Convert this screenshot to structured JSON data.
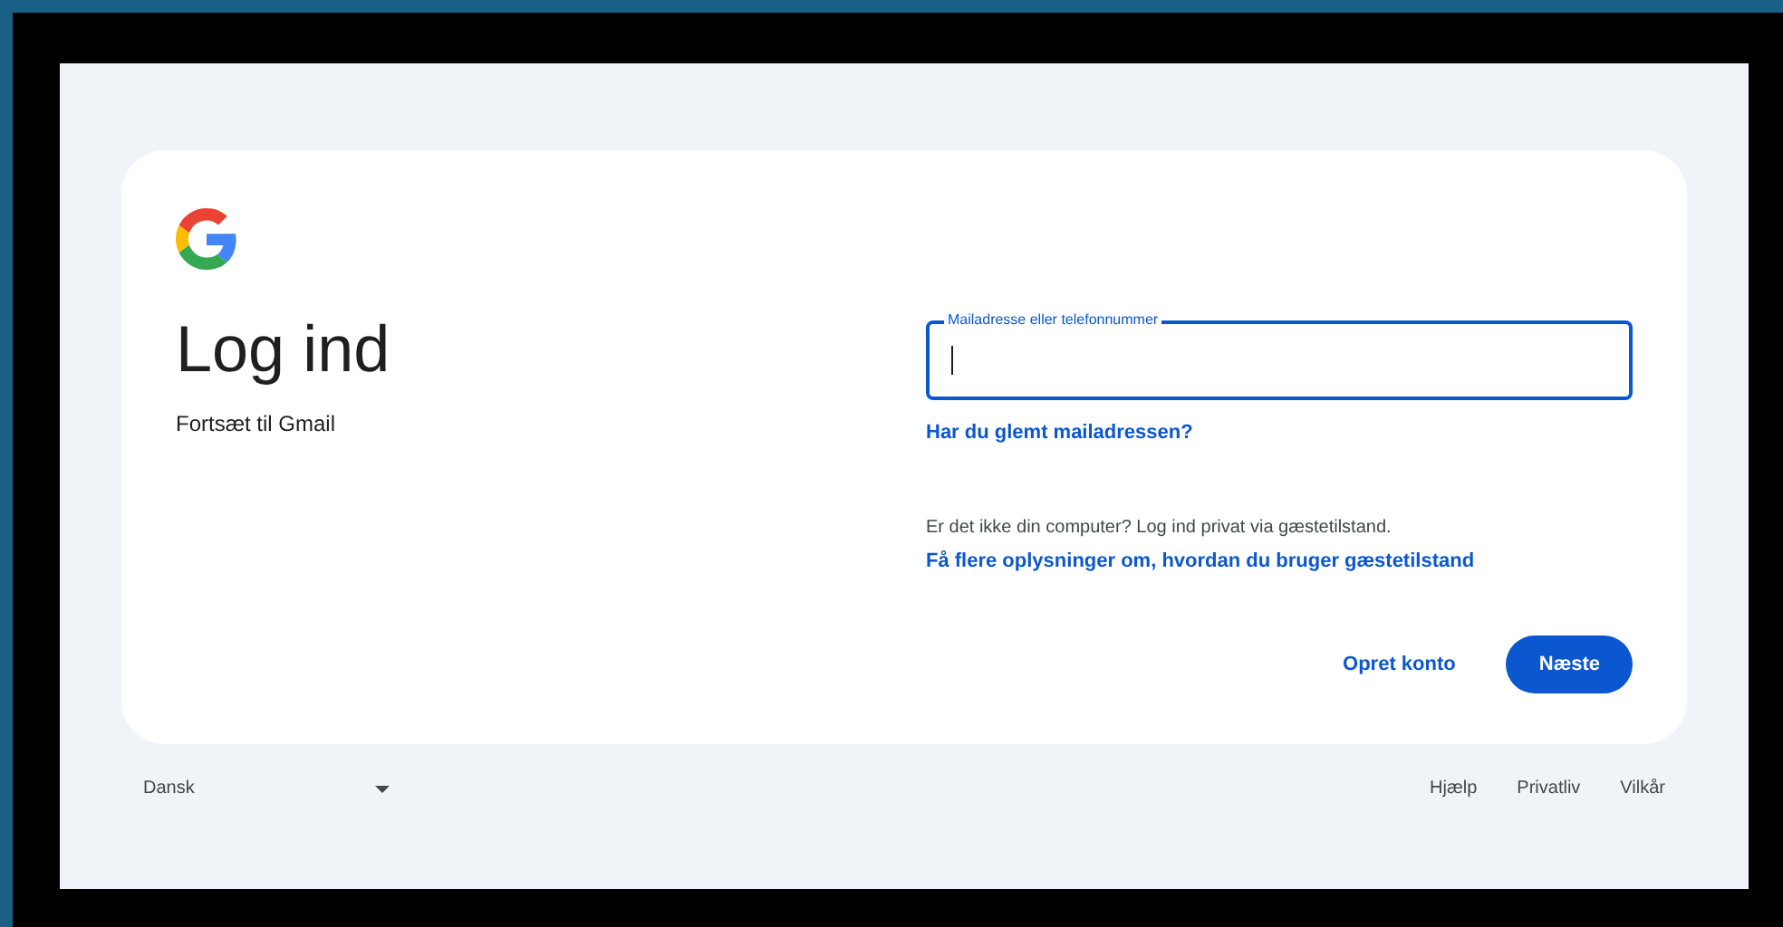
{
  "title": "Log ind",
  "subtitle": "Fortsæt til Gmail",
  "email_field": {
    "label": "Mailadresse eller telefonnummer",
    "focused": true
  },
  "forgot_link": "Har du glemt mailadressen?",
  "guest_note": "Er det ikke din computer? Log ind privat via gæstetilstand.",
  "guest_link": "Få flere oplysninger om, hvordan du bruger gæstetilstand",
  "create_account": "Opret konto",
  "next_button": "Næste",
  "footer": {
    "language": "Dansk",
    "links": [
      "Hjælp",
      "Privatliv",
      "Vilkår"
    ]
  }
}
